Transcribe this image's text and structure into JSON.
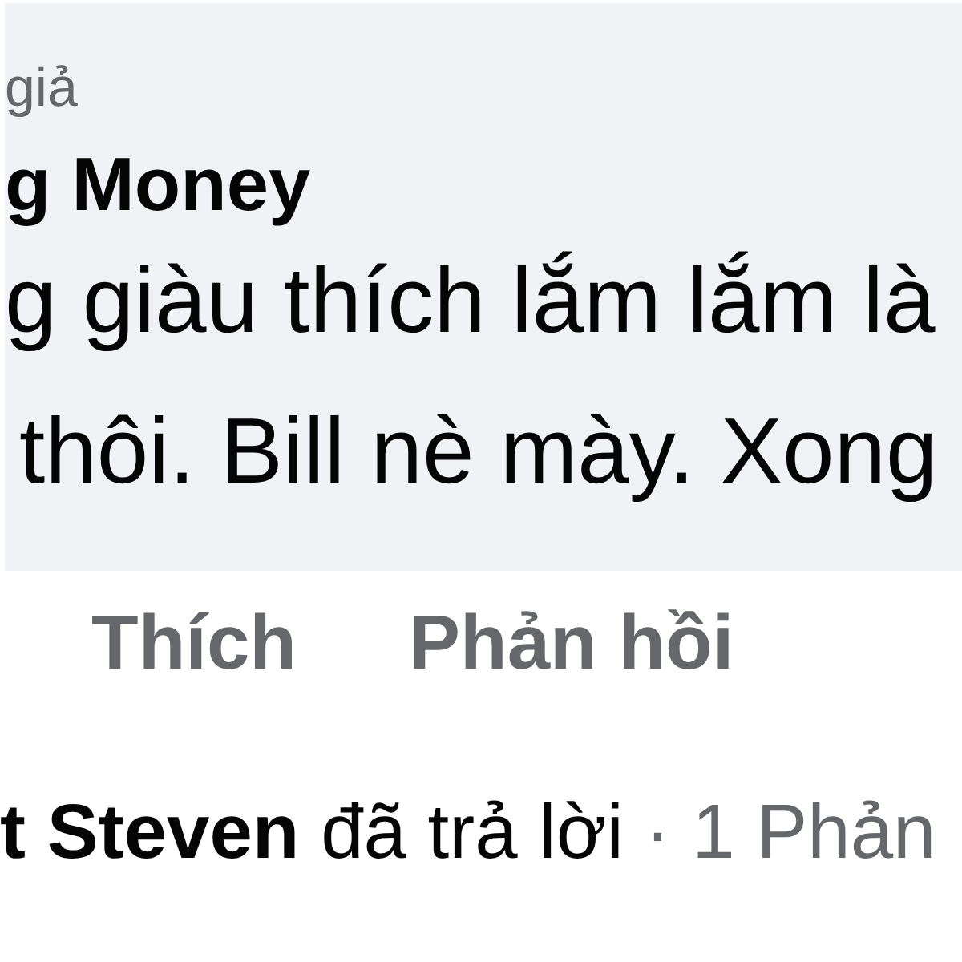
{
  "comment": {
    "role_label": "giả",
    "author": "g Money",
    "text_lines": [
      "g giàu thích lắm lắm là",
      "thôi. Bill nè mày. Xong"
    ]
  },
  "actions": [
    {
      "label": "Thích"
    },
    {
      "label": "Phản hồi"
    }
  ],
  "replies": {
    "summary": "**t Steven** đã trả lời",
    "count": "· 1 Phản"
  }
}
